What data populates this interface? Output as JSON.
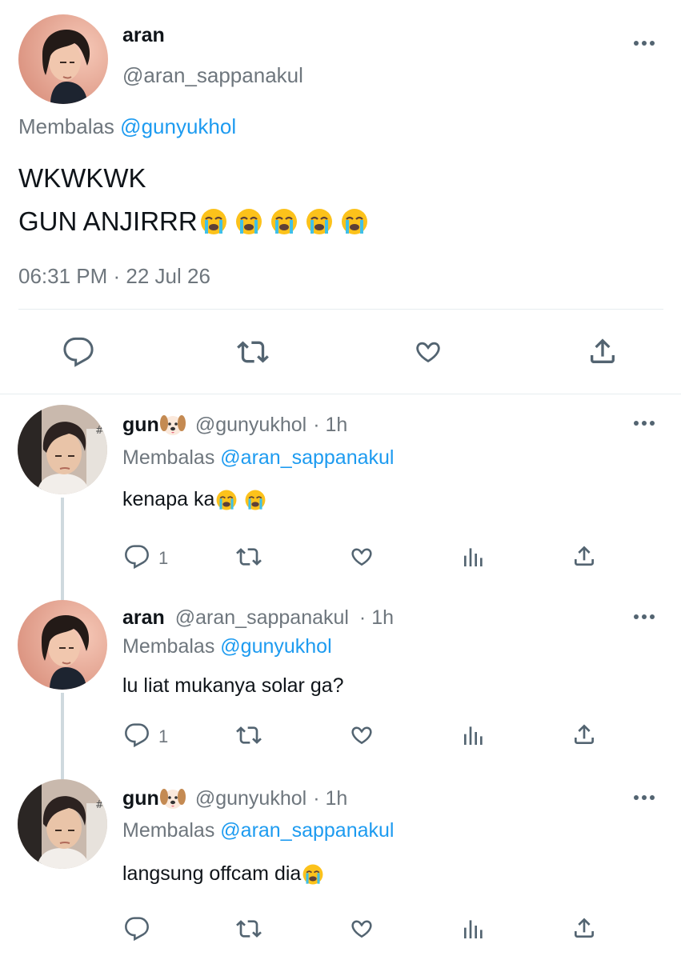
{
  "main_tweet": {
    "display_name": "aran",
    "handle": "@aran_sappanakul",
    "reply_prefix": "Membalas",
    "reply_to": "@gunyukhol",
    "text_line1": "WKWKWK",
    "text_line2": "GUN ANJIRRR",
    "timestamp": "06:31 PM · 22 Jul 26",
    "avatar_icon": "avatar-photo",
    "emojis": [
      "loudly-crying-face",
      "loudly-crying-face",
      "loudly-crying-face",
      "loudly-crying-face",
      "loudly-crying-face"
    ]
  },
  "replies": [
    {
      "display_name": "gun",
      "name_emoji": "dog-face",
      "handle": "@gunyukhol",
      "time": "· 1h",
      "reply_prefix": "Membalas",
      "reply_to": "@aran_sappanakul",
      "text": "kenapa ka",
      "reply_count": "1"
    },
    {
      "display_name": "aran",
      "handle": "@aran_sappanakul",
      "time": "· 1h",
      "reply_prefix": "Membalas",
      "reply_to": "@gunyukhol",
      "text": "lu liat mukanya solar ga?",
      "reply_count": "1"
    },
    {
      "display_name": "gun",
      "name_emoji": "dog-face",
      "handle": "@gunyukhol",
      "time": "· 1h",
      "reply_prefix": "Membalas",
      "reply_to": "@aran_sappanakul",
      "text": "langsung offcam dia",
      "reply_count": ""
    }
  ],
  "colors": {
    "text": "#0f1419",
    "secondary": "#6e767d",
    "link": "#1d9bf0",
    "divider": "#e6ecf0",
    "thread_line": "#cfd9de"
  },
  "icons": [
    "reply-icon",
    "retweet-icon",
    "like-icon",
    "share-icon",
    "views-icon",
    "more-icon"
  ]
}
